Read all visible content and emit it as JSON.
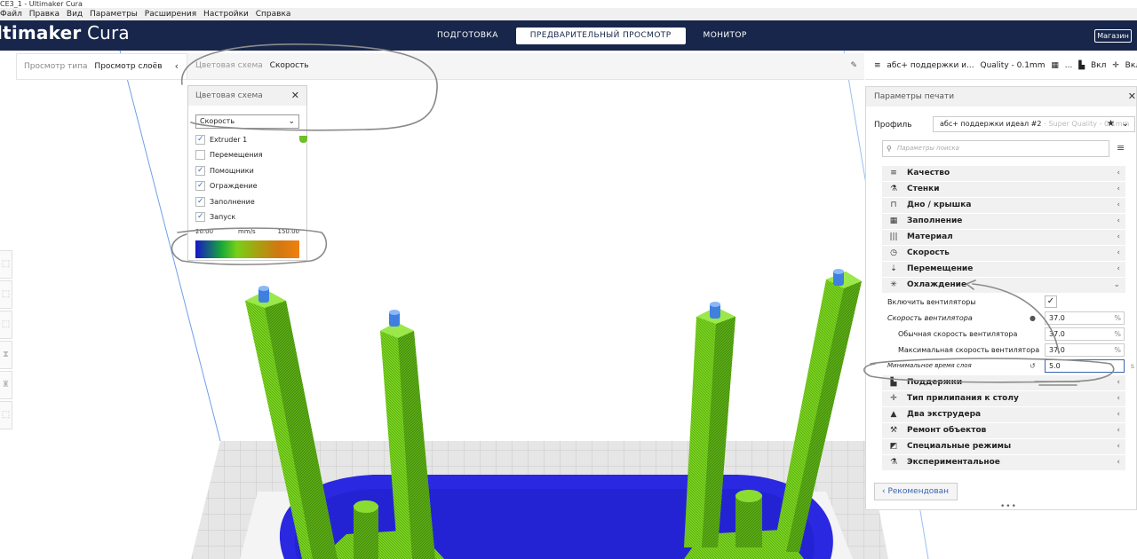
{
  "window": {
    "title": "CE3_1 - Ultimaker Cura",
    "menu": [
      "Файл",
      "Правка",
      "Вид",
      "Параметры",
      "Расширения",
      "Настройки",
      "Справка"
    ]
  },
  "header": {
    "logo_bold": "ltimaker",
    "logo_light": " Cura",
    "tabs": [
      {
        "label": "ПОДГОТОВКА",
        "active": false
      },
      {
        "label": "ПРЕДВАРИТЕЛЬНЫЙ ПРОСМОТР",
        "active": true
      },
      {
        "label": "МОНИТОР",
        "active": false
      }
    ],
    "market": "Магазин"
  },
  "view_type": {
    "label": "Просмотр типа",
    "value": "Просмотр слоёв"
  },
  "color_scheme_bar": {
    "label": "Цветовая схема",
    "value": "Скорость"
  },
  "color_scheme_panel": {
    "title": "Цветовая схема",
    "selected": "Скорость",
    "items": [
      {
        "label": "Extruder 1",
        "checked": true
      },
      {
        "label": "Перемещения",
        "checked": false
      },
      {
        "label": "Помощники",
        "checked": true
      },
      {
        "label": "Ограждение",
        "checked": true
      },
      {
        "label": "Заполнение",
        "checked": true
      },
      {
        "label": "Запуск",
        "checked": true
      }
    ],
    "legend_min": "20.00",
    "legend_unit": "mm/s",
    "legend_max": "150.00",
    "extruder_color": "#6fbe2a"
  },
  "print_bar": {
    "profile": "абс+ поддержки и...",
    "quality": "Quality - 0.1mm",
    "support": "Вкл",
    "adhesion": "Вкл"
  },
  "settings": {
    "title": "Параметры печати",
    "profile_label": "Профиль",
    "profile_value": "абс+ поддержки идеал #2",
    "profile_quality": " - Super Quality - 0.1mm",
    "search_placeholder": "Параметры поиска",
    "categories": [
      {
        "label": "Качество",
        "icon": "quality-icon",
        "glyph": "≡"
      },
      {
        "label": "Стенки",
        "icon": "walls-icon",
        "glyph": "⚗"
      },
      {
        "label": "Дно / крышка",
        "icon": "top-bottom-icon",
        "glyph": "⊓"
      },
      {
        "label": "Заполнение",
        "icon": "infill-icon",
        "glyph": "▦"
      },
      {
        "label": "Материал",
        "icon": "material-icon",
        "glyph": "|||"
      },
      {
        "label": "Скорость",
        "icon": "speed-icon",
        "glyph": "◷"
      },
      {
        "label": "Перемещение",
        "icon": "travel-icon",
        "glyph": "⇣"
      },
      {
        "label": "Охлаждение",
        "icon": "cooling-icon",
        "glyph": "✳"
      }
    ],
    "cooling": {
      "fan_enable": "Включить вентиляторы",
      "fan_speed": "Скорость вентилятора",
      "fan_speed_val": "37.0",
      "fan_normal": "Обычная скорость вентилятора",
      "fan_normal_val": "37.0",
      "fan_max": "Максимальная скорость вентилятора",
      "fan_max_val": "37.0",
      "min_layer": "Минимальное время слоя",
      "min_layer_val": "5.0",
      "unit_pct": "%",
      "unit_s": "s"
    },
    "categories2": [
      {
        "label": "Поддержки",
        "icon": "support-icon",
        "glyph": "▙"
      },
      {
        "label": "Тип прилипания к столу",
        "icon": "adhesion-icon",
        "glyph": "✛"
      },
      {
        "label": "Два экструдера",
        "icon": "dual-extrusion-icon",
        "glyph": "▲"
      },
      {
        "label": "Ремонт объектов",
        "icon": "mesh-fix-icon",
        "glyph": "⚒"
      },
      {
        "label": "Специальные режимы",
        "icon": "special-modes-icon",
        "glyph": "◩"
      },
      {
        "label": "Экспериментальное",
        "icon": "experimental-icon",
        "glyph": "⚗"
      }
    ],
    "recommended": "Рекомендован"
  }
}
